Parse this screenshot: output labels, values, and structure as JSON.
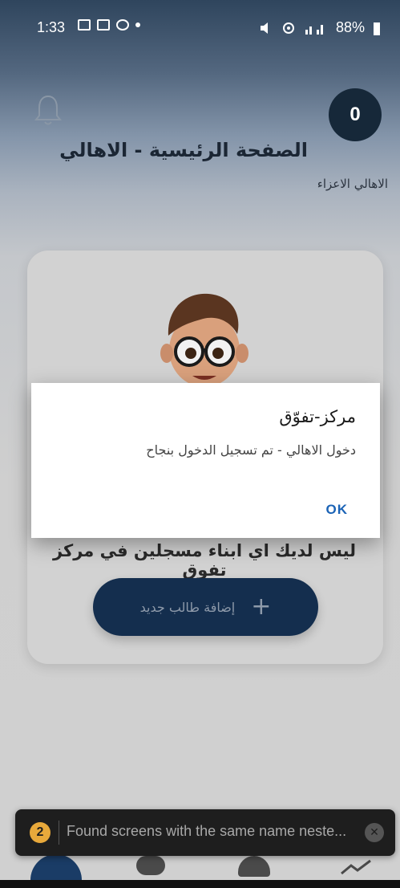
{
  "status_bar": {
    "time": "1:33",
    "battery": "88%",
    "icons": [
      "image-icon",
      "linkedin-icon",
      "facebook-icon",
      "dot-icon",
      "mute-icon",
      "hotspot-icon",
      "data-icon",
      "signal-icon",
      "battery-icon"
    ]
  },
  "header": {
    "notification_count": "0",
    "title": "الصفحة الرئيسية - الاهالي",
    "subtitle": "الاهالي الاعزاء"
  },
  "card": {
    "message": "ليس لديك اي ابناء مسجلين في مركز تفوق",
    "add_button_label": "إضافة طالب جديد",
    "add_button_icon": "plus-icon"
  },
  "dialog": {
    "title": "مركز-تفوّق",
    "body": "دخول الاهالي - تم تسجيل الدخول بنجاح",
    "ok_label": "OK"
  },
  "toast": {
    "badge": "2",
    "text": "Found screens with the same name neste..."
  },
  "bottom_nav": {
    "items": [
      "home-icon",
      "chat-icon",
      "person-icon",
      "chart-icon"
    ]
  },
  "colors": {
    "accent": "#142e4e",
    "dialog_ok": "#1b63b6",
    "toast_badge": "#e8a93b"
  }
}
